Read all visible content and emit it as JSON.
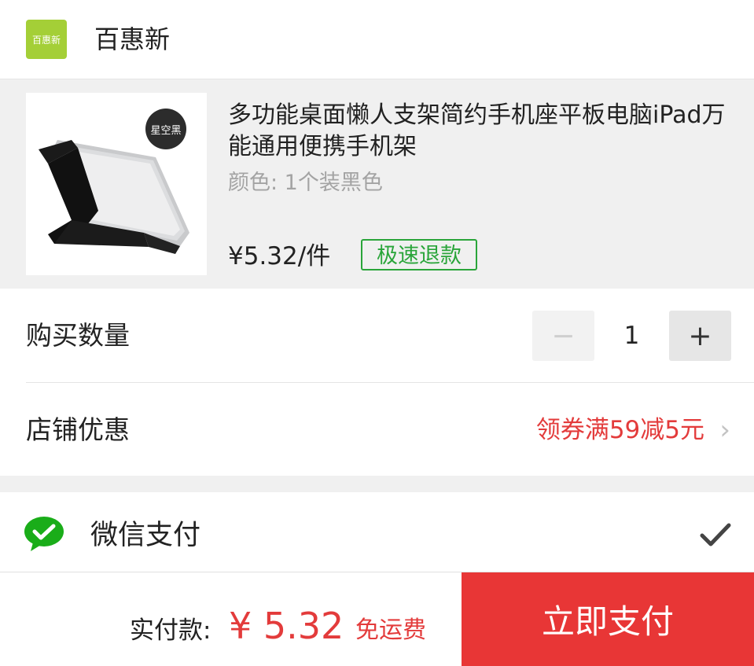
{
  "shop": {
    "logo_text": "百惠新",
    "name": "百惠新"
  },
  "product": {
    "badge": "星空黑",
    "title": "多功能桌面懒人支架简约手机座平板电脑iPad万能通用便携手机架",
    "spec": "颜色: 1个装黑色",
    "price": "¥5.32/件",
    "refund_badge": "极速退款"
  },
  "quantity": {
    "label": "购买数量",
    "minus": "−",
    "value": "1",
    "plus": "+"
  },
  "coupon": {
    "label": "店铺优惠",
    "text": "领券满59减5元",
    "chevron": "›"
  },
  "payment": {
    "method": "微信支付",
    "selected": true
  },
  "footer": {
    "total_label": "实付款:",
    "total_amount": "¥ 5.32",
    "shipping": "免运费",
    "pay_button": "立即支付"
  },
  "colors": {
    "accent_red": "#e83636",
    "price_red": "#e33b3b",
    "refund_green": "#2aa53a",
    "wechat_green": "#1aad19",
    "logo_green": "#a4cf37"
  }
}
